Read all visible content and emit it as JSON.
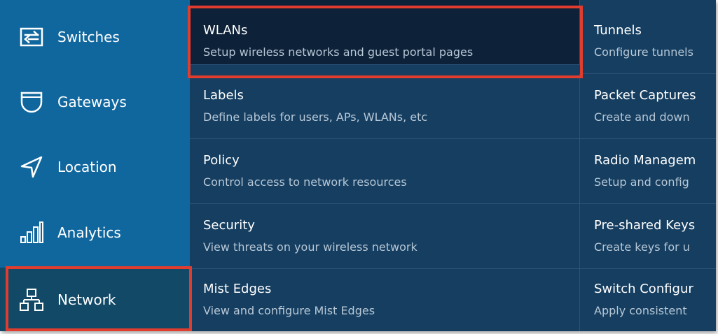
{
  "sidebar": {
    "items": [
      {
        "label": "Switches",
        "icon": "switch-icon"
      },
      {
        "label": "Gateways",
        "icon": "shield-icon"
      },
      {
        "label": "Location",
        "icon": "location-arrow-icon"
      },
      {
        "label": "Analytics",
        "icon": "bar-chart-icon"
      },
      {
        "label": "Network",
        "icon": "network-topology-icon",
        "active": true
      }
    ]
  },
  "menu": {
    "col1": [
      {
        "title": "WLANs",
        "desc": "Setup wireless networks and guest portal pages",
        "active": true
      },
      {
        "title": "Labels",
        "desc": "Define labels for users, APs, WLANs, etc"
      },
      {
        "title": "Policy",
        "desc": "Control access to network resources"
      },
      {
        "title": "Security",
        "desc": "View threats on your wireless network"
      },
      {
        "title": "Mist Edges",
        "desc": "View and configure Mist Edges"
      }
    ],
    "col2": [
      {
        "title": "Tunnels",
        "desc": "Configure tunnels"
      },
      {
        "title": "Packet Captures",
        "desc": "Create and down"
      },
      {
        "title": "Radio Managem",
        "desc": "Setup and config"
      },
      {
        "title": "Pre-shared Keys",
        "desc": "Create keys for u"
      },
      {
        "title": "Switch Configur",
        "desc": "Apply consistent"
      }
    ]
  },
  "colors": {
    "sidebar_bg": "#10679e",
    "sidebar_active": "#114967",
    "menu_bg": "#153e60",
    "menu_active": "#0d2138",
    "highlight": "#e13d2f"
  }
}
